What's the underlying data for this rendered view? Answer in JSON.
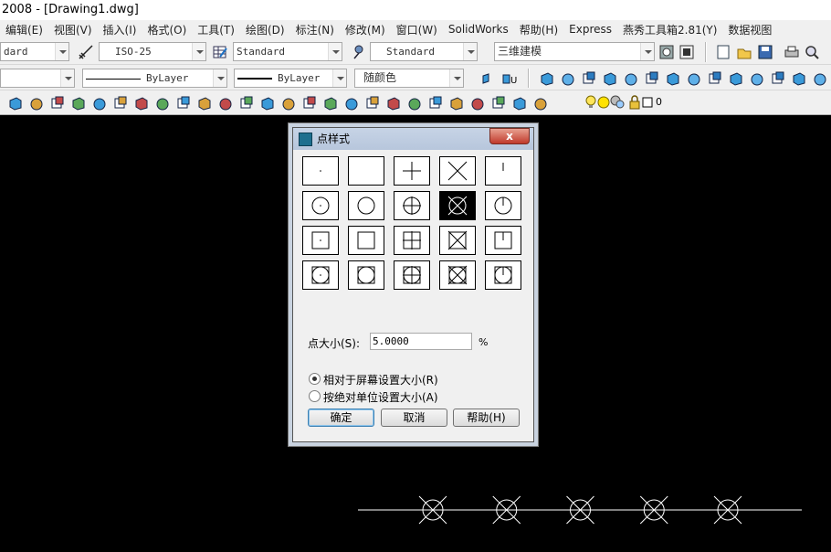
{
  "window": {
    "title": "2008 - [Drawing1.dwg]"
  },
  "menu": [
    "编辑(E)",
    "视图(V)",
    "插入(I)",
    "格式(O)",
    "工具(T)",
    "绘图(D)",
    "标注(N)",
    "修改(M)",
    "窗口(W)",
    "SolidWorks",
    "帮助(H)",
    "Express",
    "燕秀工具箱2.81(Y)",
    "数据视图"
  ],
  "toolbar1": {
    "text_style": "dard",
    "dim_style": "ISO-25",
    "table_style": "Standard",
    "mleader_style": "Standard",
    "workspace": "三维建模"
  },
  "toolbar2": {
    "layer": "",
    "linetype": "ByLayer",
    "lineweight": "ByLayer",
    "color": "随颜色"
  },
  "toolbar3": {
    "layer_count": "0"
  },
  "dialog": {
    "title": "点样式",
    "close_label": "x",
    "selected_style_index": 8,
    "size_label": "点大小(S):",
    "size_value": "5.0000",
    "size_unit": "%",
    "radio_relative": "相对于屏幕设置大小(R)",
    "radio_absolute": "按绝对单位设置大小(A)",
    "relative_selected": true,
    "ok": "确定",
    "cancel": "取消",
    "help": "帮助(H)"
  },
  "canvas": {
    "point_count": 5
  }
}
